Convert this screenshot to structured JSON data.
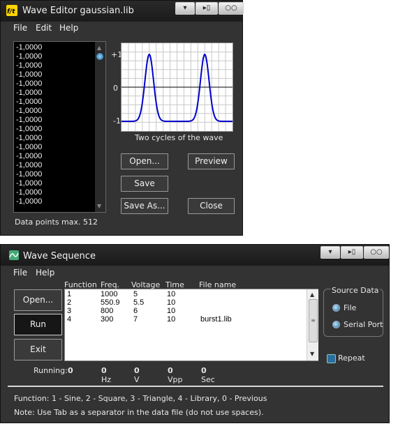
{
  "wave_editor": {
    "title": "Wave Editor gaussian.lib",
    "menu": {
      "file": "File",
      "edit": "Edit",
      "help": "Help"
    },
    "data_values": [
      "-1,0000",
      "-1,0000",
      "-1,0000",
      "-1,0000",
      "-1,0000",
      "-1,0000",
      "-1,0000",
      "-1,0000",
      "-1,0000",
      "-1,0000",
      "-1,0000",
      "-1,0000",
      "-1,0000",
      "-1,0000",
      "-1,0000",
      "-1,0000",
      "-1,0000",
      "-1,0000"
    ],
    "y_axis": {
      "top": "+1",
      "mid": "0",
      "bottom": "-1"
    },
    "graph_caption": "Two cycles of the wave",
    "buttons": {
      "open": "Open...",
      "preview": "Preview",
      "save": "Save",
      "save_as": "Save As...",
      "close": "Close"
    },
    "status": "Data points max. 512",
    "wave_color": "#0000cc"
  },
  "wave_sequence": {
    "title": "Wave Sequence",
    "menu": {
      "file": "File",
      "help": "Help"
    },
    "buttons": {
      "open": "Open...",
      "run": "Run",
      "exit": "Exit"
    },
    "table": {
      "headers": {
        "function": "Function",
        "freq": "Freq.",
        "voltage": "Voltage",
        "time": "Time",
        "file_name": "File name"
      },
      "rows": [
        {
          "function": "1",
          "freq": "1000",
          "voltage": "5",
          "time": "10",
          "file_name": ""
        },
        {
          "function": "2",
          "freq": "550.9",
          "voltage": "5.5",
          "time": "10",
          "file_name": ""
        },
        {
          "function": "3",
          "freq": "800",
          "voltage": "6",
          "time": "10",
          "file_name": ""
        },
        {
          "function": "4",
          "freq": "300",
          "voltage": "7",
          "time": "10",
          "file_name": "burst1.lib"
        }
      ]
    },
    "source_data": {
      "label": "Source Data",
      "file": "File",
      "serial_port": "Serial Port"
    },
    "repeat": "Repeat",
    "running": {
      "label": "Running:",
      "function": "0",
      "freq": "0",
      "freq_unit": "Hz",
      "voltage": "0",
      "voltage_unit": "V",
      "vpp": "0",
      "vpp_unit": "Vpp",
      "time": "0",
      "time_unit": "Sec"
    },
    "help_function": "Function: 1 - Sine, 2 - Square, 3 - Triangle, 4 - Library, 0 - Previous",
    "help_note": "Note: Use Tab as a separator in the data file (do not use spaces)."
  }
}
